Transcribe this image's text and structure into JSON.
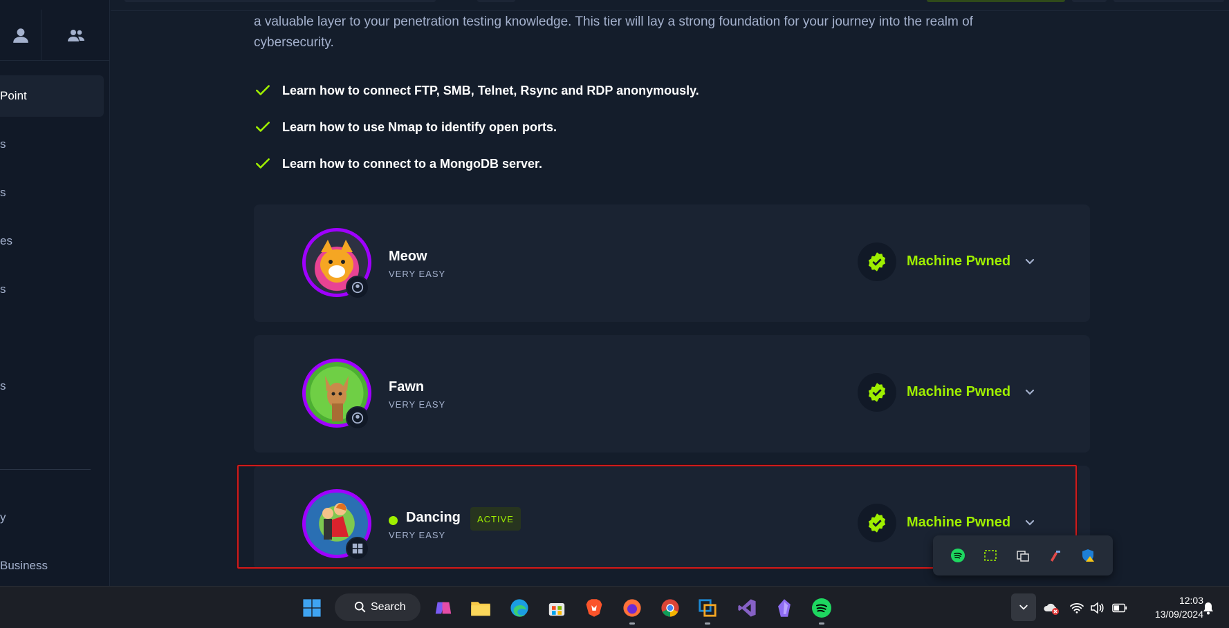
{
  "sidebar": {
    "items": [
      {
        "label": "Point",
        "top": 0
      },
      {
        "label": "s"
      },
      {
        "label": "s"
      },
      {
        "label": "es"
      },
      {
        "label": "s"
      },
      {
        "label": "s"
      },
      {
        "label": "y"
      },
      {
        "label": "Business"
      }
    ]
  },
  "main": {
    "intro": "a valuable layer to your penetration testing knowledge. This tier will lay a strong foundation for your journey into the realm of cybersecurity.",
    "goals": [
      "Learn how to connect FTP, SMB, Telnet, Rsync and RDP anonymously.",
      "Learn how to use Nmap to identify open ports.",
      "Learn how to connect to a MongoDB server."
    ],
    "machines": [
      {
        "name": "Meow",
        "difficulty": "VERY EASY",
        "status": "Machine Pwned",
        "os": "linux"
      },
      {
        "name": "Fawn",
        "difficulty": "VERY EASY",
        "status": "Machine Pwned",
        "os": "linux"
      },
      {
        "name": "Dancing",
        "difficulty": "VERY EASY",
        "status": "Machine Pwned",
        "os": "windows",
        "badge": "ACTIVE"
      }
    ]
  },
  "taskbar": {
    "search_label": "Search",
    "time": "12:03",
    "date": "13/09/2024"
  },
  "colors": {
    "accent": "#9fef00",
    "background": "#141d2b",
    "card": "#1a2332",
    "avatar_ring": "#9f00ff",
    "highlight": "#d11a1a"
  }
}
